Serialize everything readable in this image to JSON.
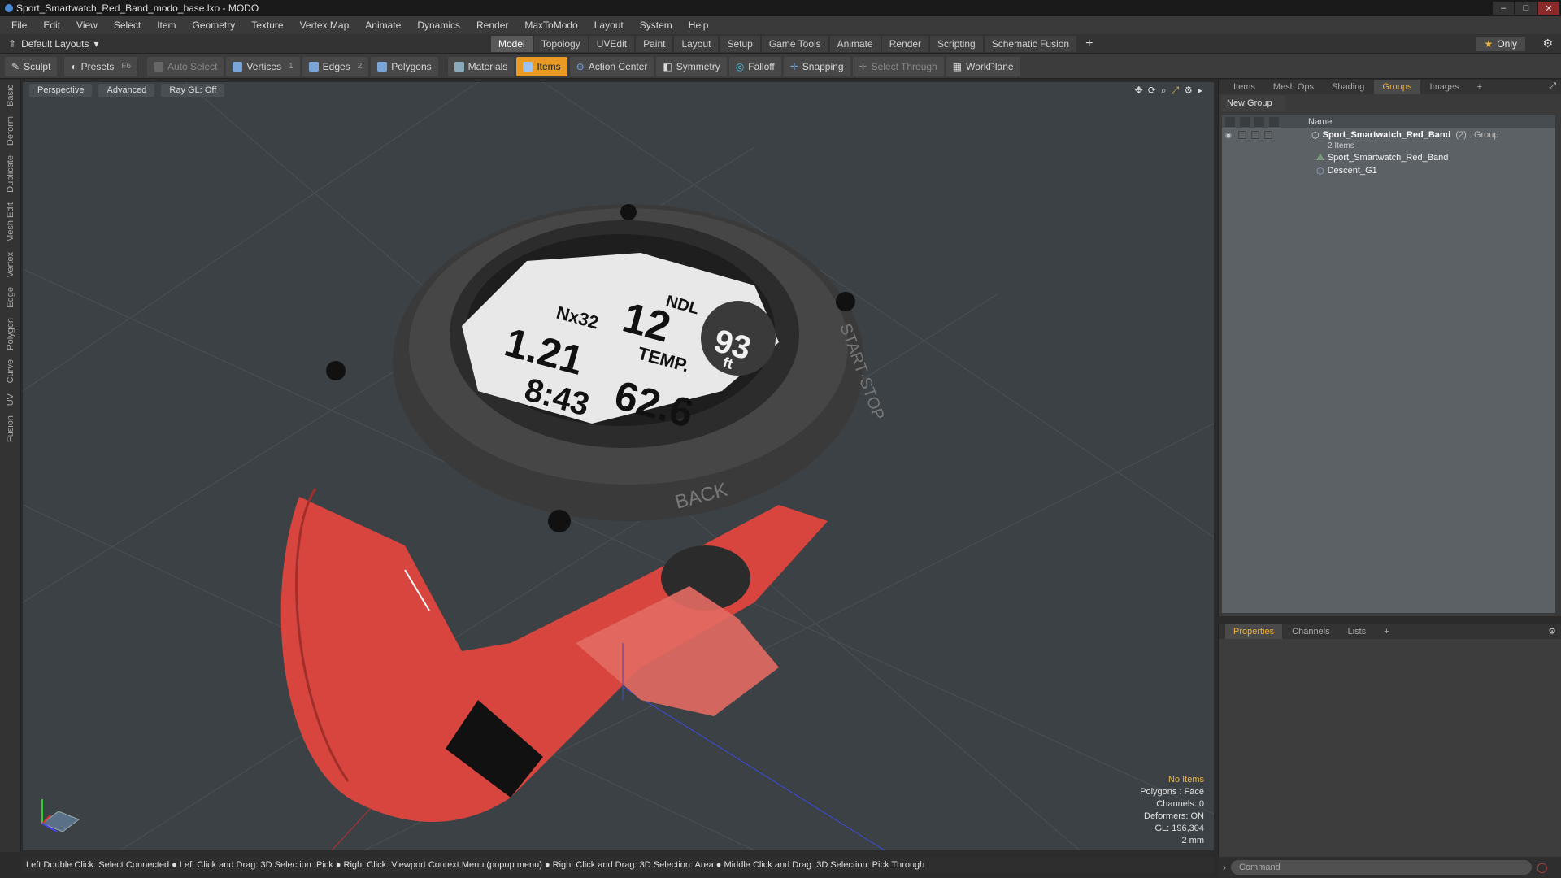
{
  "window": {
    "title": "Sport_Smartwatch_Red_Band_modo_base.lxo - MODO",
    "buttons": [
      "–",
      "□",
      "✕"
    ]
  },
  "menu": [
    "File",
    "Edit",
    "View",
    "Select",
    "Item",
    "Geometry",
    "Texture",
    "Vertex Map",
    "Animate",
    "Dynamics",
    "Render",
    "MaxToModo",
    "Layout",
    "System",
    "Help"
  ],
  "layoutbar": {
    "default_layouts": "Default Layouts",
    "tabs": [
      "Model",
      "Topology",
      "UVEdit",
      "Paint",
      "Layout",
      "Setup",
      "Game Tools",
      "Animate",
      "Render",
      "Scripting",
      "Schematic Fusion"
    ],
    "active_tab": "Model",
    "plus": "+",
    "only": "Only"
  },
  "toolbar": {
    "sculpt": "Sculpt",
    "presets": "Presets",
    "presets_key": "F6",
    "auto_select": "Auto Select",
    "vertices": "Vertices",
    "vertices_count": "1",
    "edges": "Edges",
    "edges_count": "2",
    "polygons": "Polygons",
    "materials": "Materials",
    "items": "Items",
    "action_center": "Action Center",
    "symmetry": "Symmetry",
    "falloff": "Falloff",
    "snapping": "Snapping",
    "select_through": "Select Through",
    "workplane": "WorkPlane"
  },
  "left_tabs": [
    "Basic",
    "Deform",
    "Duplicate",
    "Mesh Edit",
    "Vertex",
    "Edge",
    "Polygon",
    "Curve",
    "UV",
    "Fusion"
  ],
  "viewport": {
    "view": "Perspective",
    "advanced": "Advanced",
    "raygl": "Ray GL: Off",
    "info": {
      "no_items": "No Items",
      "polygons": "Polygons : Face",
      "channels": "Channels: 0",
      "deformers": "Deformers: ON",
      "gl": "GL: 196,304",
      "unit": "2 mm"
    },
    "watch": {
      "ndl": "NDL",
      "ndl_value": "12",
      "depth": "93",
      "depth_unit": "ft",
      "gas": "Nx32",
      "ppo2": "1.21",
      "temp_label": "TEMP.",
      "temp": "62.6",
      "time": "8:43",
      "bezel_right": "START·STOP",
      "bezel_bottom": "BACK"
    }
  },
  "statusbar": "Left Double Click: Select Connected ● Left Click and Drag: 3D Selection: Pick ● Right Click: Viewport Context Menu (popup menu) ● Right Click and Drag: 3D Selection: Area ● Middle Click and Drag: 3D Selection: Pick Through",
  "right_panel": {
    "tabs": [
      "Items",
      "Mesh Ops",
      "Shading",
      "Groups",
      "Images"
    ],
    "active_tab": "Groups",
    "new_group": "New Group",
    "name_header": "Name",
    "group_name": "Sport_Smartwatch_Red_Band",
    "group_suffix": "(2) : Group",
    "group_count": "2 Items",
    "children": [
      "Sport_Smartwatch_Red_Band",
      "Descent_G1"
    ]
  },
  "properties_panel": {
    "tabs": [
      "Properties",
      "Channels",
      "Lists"
    ],
    "active_tab": "Properties"
  },
  "command": {
    "placeholder": "Command"
  }
}
